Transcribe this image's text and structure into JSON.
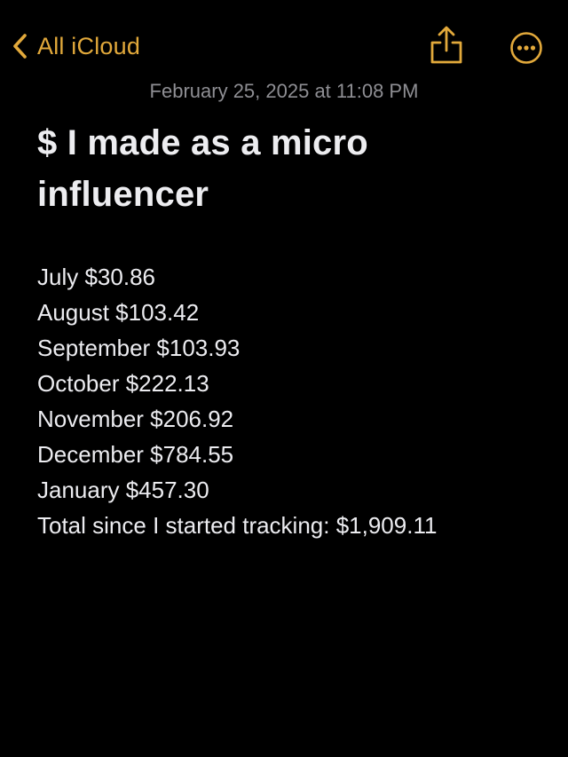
{
  "nav": {
    "back_label": "All iCloud",
    "back_icon": "chevron-left-icon",
    "share_icon": "share-icon",
    "more_icon": "ellipsis-circle-icon",
    "accent_color": "#e2a93b"
  },
  "note": {
    "timestamp": "February 25, 2025 at 11:08 PM",
    "title": "$ I made as a micro influencer",
    "lines": [
      "July $30.86",
      "August $103.42",
      "September $103.93",
      "October $222.13",
      "November $206.92",
      "December $784.55",
      "January $457.30",
      "Total since I started tracking: $1,909.11"
    ]
  }
}
